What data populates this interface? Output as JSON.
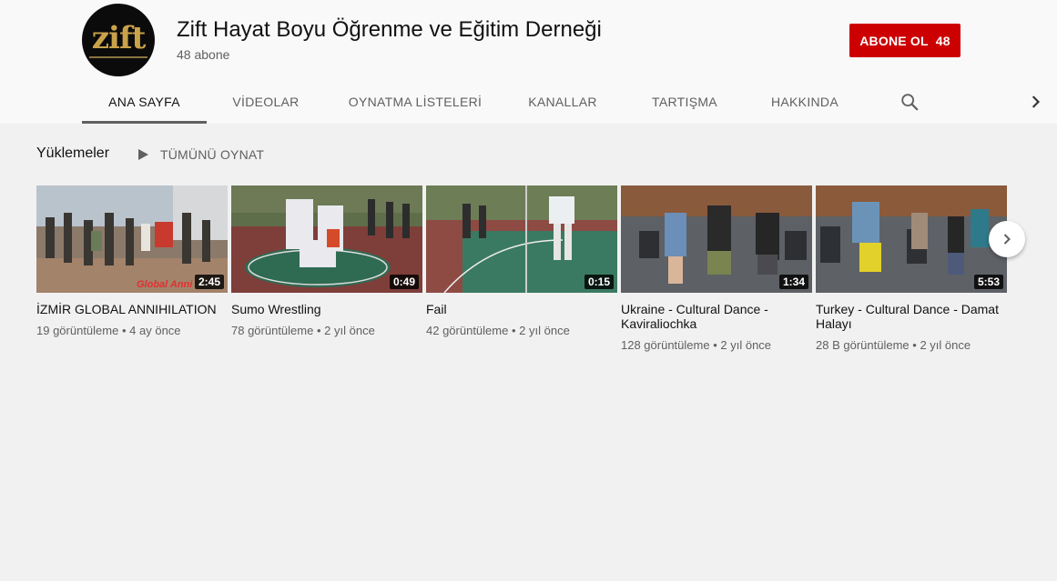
{
  "channel": {
    "title": "Zift Hayat Boyu Öğrenme ve Eğitim Derneği",
    "subscribers": "48 abone",
    "avatar_text": "zift"
  },
  "subscribe": {
    "label": "ABONE OL",
    "count": "48",
    "color": "#cc0000"
  },
  "tabs": [
    {
      "label": "ANA SAYFA",
      "active": true
    },
    {
      "label": "VİDEOLAR"
    },
    {
      "label": "OYNATMA LİSTELERİ"
    },
    {
      "label": "KANALLAR"
    },
    {
      "label": "TARTIŞMA"
    },
    {
      "label": "HAKKINDA"
    }
  ],
  "icons": {
    "search": "search-icon",
    "tabs_next": "chevron-right-icon",
    "play_all": "play-icon",
    "shelf_next": "chevron-right-icon"
  },
  "section": {
    "title": "Yüklemeler",
    "play_all": "TÜMÜNÜ OYNAT"
  },
  "videos": [
    {
      "title": "İZMİR GLOBAL ANNIHILATION",
      "views": "19 görüntüleme",
      "age": "4 ay önce",
      "duration": "2:45",
      "overlay": "Global Anni"
    },
    {
      "title": "Sumo Wrestling",
      "views": "78 görüntüleme",
      "age": "2 yıl önce",
      "duration": "0:49"
    },
    {
      "title": "Fail",
      "views": "42 görüntüleme",
      "age": "2 yıl önce",
      "duration": "0:15"
    },
    {
      "title": "Ukraine - Cultural Dance - Kaviraliochka",
      "views": "128 görüntüleme",
      "age": "2 yıl önce",
      "duration": "1:34"
    },
    {
      "title": "Turkey - Cultural Dance - Damat Halayı",
      "views": "28 B görüntüleme",
      "age": "2 yıl önce",
      "duration": "5:53"
    }
  ],
  "meta_separator": "•"
}
